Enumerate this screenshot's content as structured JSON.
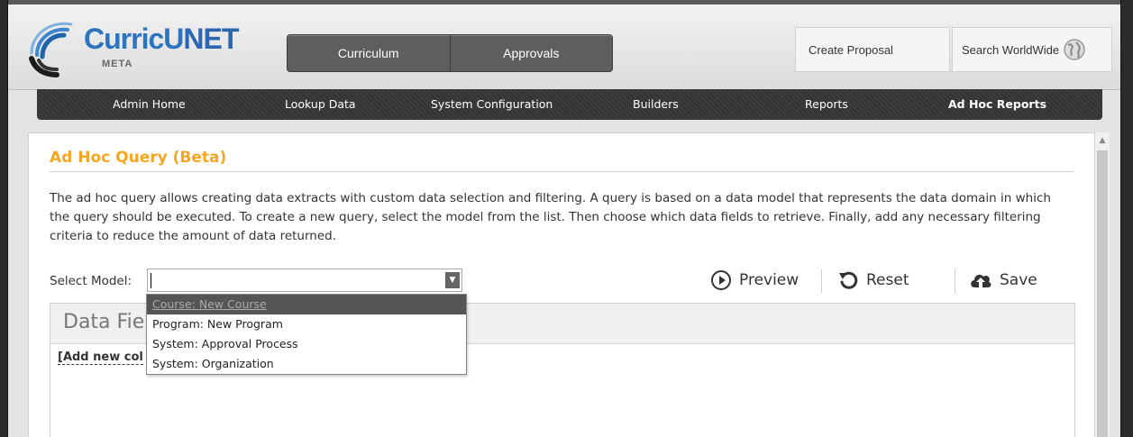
{
  "brand": {
    "name_part1": "CurricU",
    "name_part2": "NET",
    "sub": "META"
  },
  "main_nav": {
    "tabs": [
      "Curriculum",
      "Approvals"
    ]
  },
  "header_buttons": {
    "create": "Create Proposal",
    "search": "Search WorldWide"
  },
  "admin_nav": {
    "items": [
      "Admin Home",
      "Lookup Data",
      "System Configuration",
      "Builders",
      "Reports",
      "Ad Hoc Reports"
    ],
    "active": "Ad Hoc Reports"
  },
  "page": {
    "title": "Ad Hoc Query (Beta)",
    "description": "The ad hoc query allows creating data extracts with custom data selection and filtering. A query is based on a data model that represents the data domain in which the query should be executed. To create a new query, select the model from the list. Then choose which data fields to retrieve. Finally, add any necessary filtering criteria to reduce the amount of data returned."
  },
  "model_select": {
    "label": "Select Model:",
    "value": "",
    "options": [
      "Course: New Course",
      "Program: New Program",
      "System: Approval Process",
      "System: Organization"
    ],
    "highlighted": "Course: New Course"
  },
  "actions": {
    "preview": "Preview",
    "reset": "Reset",
    "save": "Save"
  },
  "data_fields": {
    "title": "Data Fie",
    "add_column": "[Add new col"
  },
  "colors": {
    "accent_orange": "#f5a623",
    "brand_blue": "#2a74c0",
    "nav_dark": "#3a3a3a"
  }
}
